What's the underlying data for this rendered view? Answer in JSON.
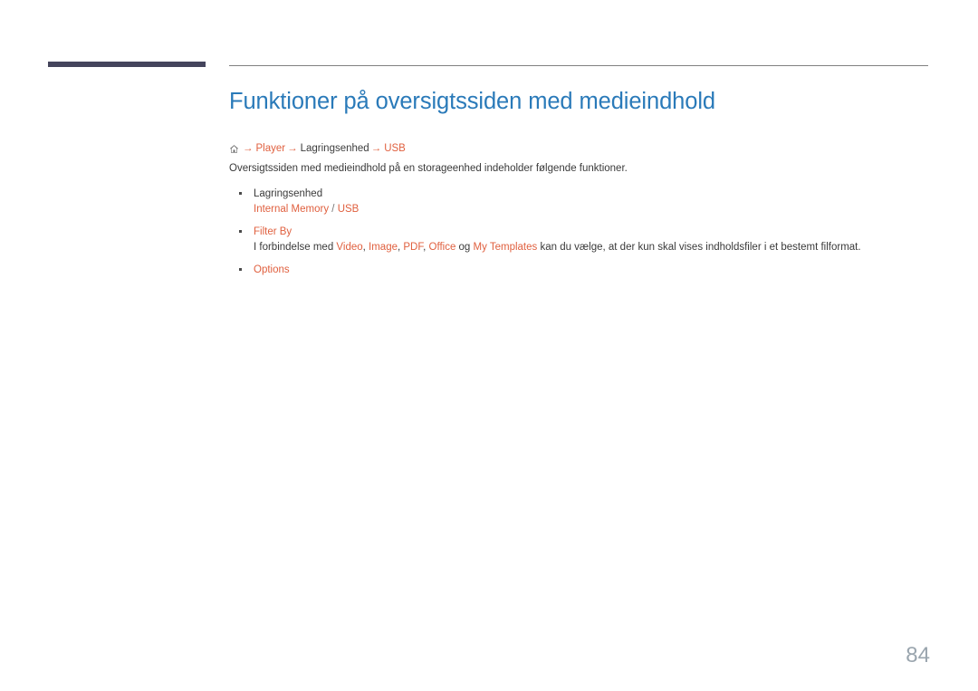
{
  "document": {
    "page_number": "84",
    "title": "Funktioner på oversigtssiden med medieindhold",
    "accent_color": "#e0603f",
    "title_color": "#2a7ab9",
    "rule_color": "#808080",
    "deco_bar_color": "#44445c",
    "page_number_color": "#9aa5ae"
  },
  "breadcrumb": {
    "home_icon": "home-icon",
    "separator": "→",
    "items": [
      {
        "label": "Player",
        "accent": true
      },
      {
        "label": "Lagringsenhed",
        "accent": false
      },
      {
        "label": "USB",
        "accent": true
      }
    ]
  },
  "intro": {
    "text": "Oversigtssiden med medieindhold på en storageenhed indeholder følgende funktioner."
  },
  "bullets": [
    {
      "head": "Lagringsenhed",
      "head_accent": false,
      "sub": {
        "parts": [
          {
            "text": "Internal Memory",
            "style": "kw"
          },
          {
            "text": " / ",
            "style": "sl"
          },
          {
            "text": "USB",
            "style": "kw"
          }
        ]
      }
    },
    {
      "head": "Filter By",
      "head_accent": true,
      "sub": {
        "parts": [
          {
            "text": "I forbindelse med ",
            "style": "plain"
          },
          {
            "text": "Video",
            "style": "kw"
          },
          {
            "text": ", ",
            "style": "plain"
          },
          {
            "text": "Image",
            "style": "kw"
          },
          {
            "text": ", ",
            "style": "plain"
          },
          {
            "text": "PDF",
            "style": "kw"
          },
          {
            "text": ", ",
            "style": "plain"
          },
          {
            "text": "Office",
            "style": "kw"
          },
          {
            "text": " og ",
            "style": "plain"
          },
          {
            "text": "My Templates",
            "style": "kw"
          },
          {
            "text": " kan du vælge, at der kun skal vises indholdsfiler i et bestemt filformat.",
            "style": "plain"
          }
        ]
      }
    },
    {
      "head": "Options",
      "head_accent": true,
      "sub": null
    }
  ]
}
